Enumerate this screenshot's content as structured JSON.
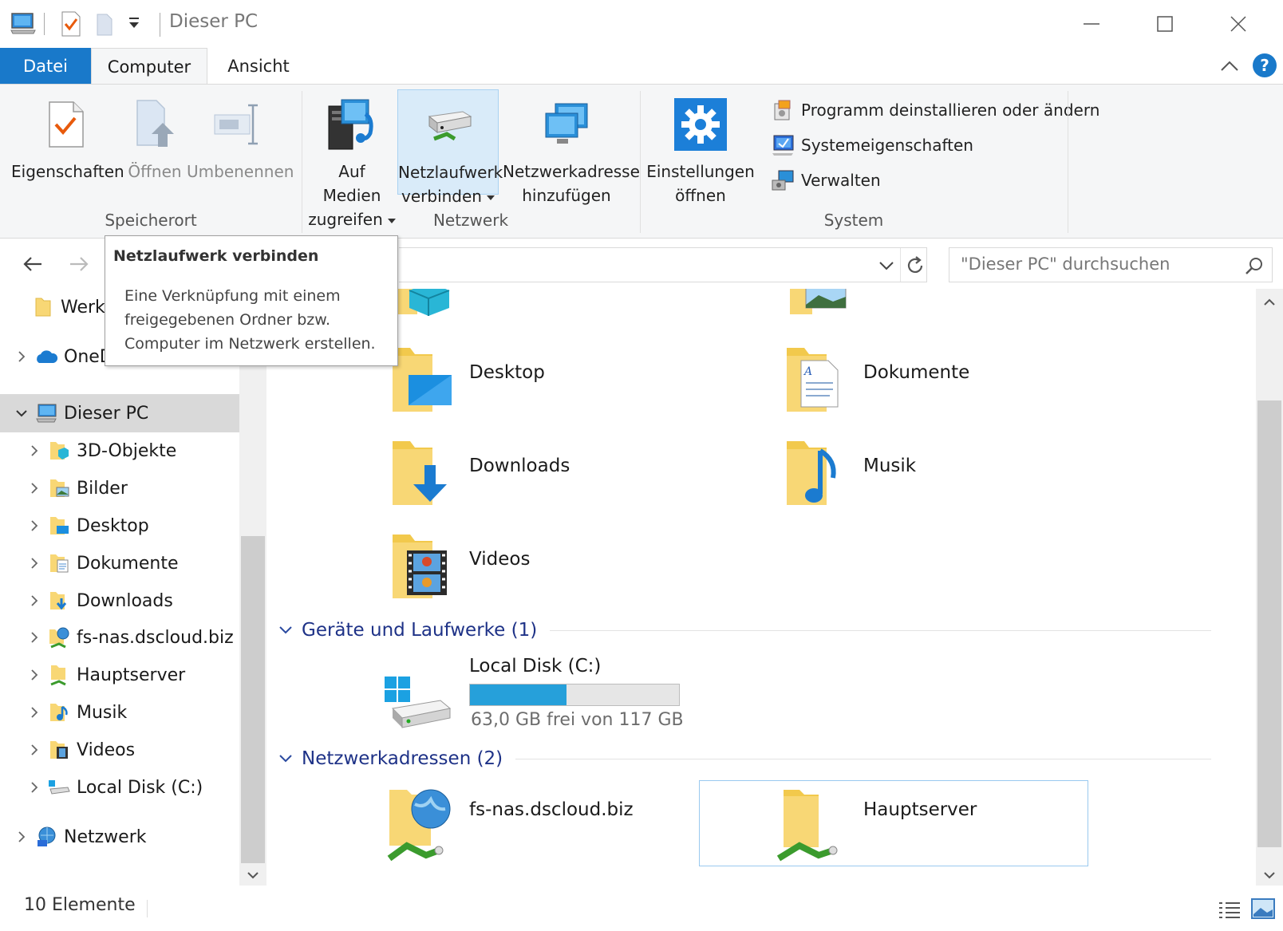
{
  "window": {
    "title": "Dieser PC"
  },
  "tabs": [
    {
      "label": "Datei"
    },
    {
      "label": "Computer"
    },
    {
      "label": "Ansicht"
    }
  ],
  "help_label": "?",
  "ribbon": {
    "speicherort": {
      "label": "Speicherort",
      "eigenschaften": "Eigenschaften",
      "oeffnen": "Öffnen",
      "umbenennen": "Umbenennen"
    },
    "netzwerk": {
      "label": "Netzwerk",
      "medien_line1": "Auf Medien",
      "medien_line2": "zugreifen",
      "laufwerk_line1": "Netzlaufwerk",
      "laufwerk_line2": "verbinden",
      "adresse_line1": "Netzwerkadresse",
      "adresse_line2": "hinzufügen"
    },
    "system": {
      "label": "System",
      "einstellungen_line1": "Einstellungen",
      "einstellungen_line2": "öffnen",
      "programm": "Programm deinstallieren oder ändern",
      "systemeigenschaften": "Systemeigenschaften",
      "verwalten": "Verwalten"
    }
  },
  "search": {
    "placeholder": "\"Dieser PC\" durchsuchen"
  },
  "tooltip": {
    "title": "Netzlaufwerk verbinden",
    "body": "Eine Verknüpfung mit einem freigegebenen Ordner bzw. Computer im Netzwerk erstellen."
  },
  "navpane": {
    "items": [
      {
        "label": "Werkzeuge"
      },
      {
        "label": "OneDrive"
      },
      {
        "label": "Dieser PC"
      },
      {
        "label": "3D-Objekte"
      },
      {
        "label": "Bilder"
      },
      {
        "label": "Desktop"
      },
      {
        "label": "Dokumente"
      },
      {
        "label": "Downloads"
      },
      {
        "label": "fs-nas.dscloud.biz"
      },
      {
        "label": "Hauptserver"
      },
      {
        "label": "Musik"
      },
      {
        "label": "Videos"
      },
      {
        "label": "Local Disk (C:)"
      },
      {
        "label": "Netzwerk"
      }
    ]
  },
  "content": {
    "folders": [
      {
        "label": "Desktop"
      },
      {
        "label": "Dokumente"
      },
      {
        "label": "Downloads"
      },
      {
        "label": "Musik"
      },
      {
        "label": "Videos"
      }
    ],
    "devices_header": "Geräte und Laufwerke (1)",
    "disk": {
      "label": "Local Disk (C:)",
      "free_text": "63,0 GB frei von 117 GB",
      "used_fraction": 0.46
    },
    "network_header": "Netzwerkadressen (2)",
    "network": [
      {
        "label": "fs-nas.dscloud.biz"
      },
      {
        "label": "Hauptserver"
      }
    ]
  },
  "status": {
    "count": "10 Elemente"
  },
  "colors": {
    "accent": "#1979ca",
    "disk_fill": "#26a0da",
    "section_header": "#1e3287",
    "folder": "#f8d775"
  }
}
